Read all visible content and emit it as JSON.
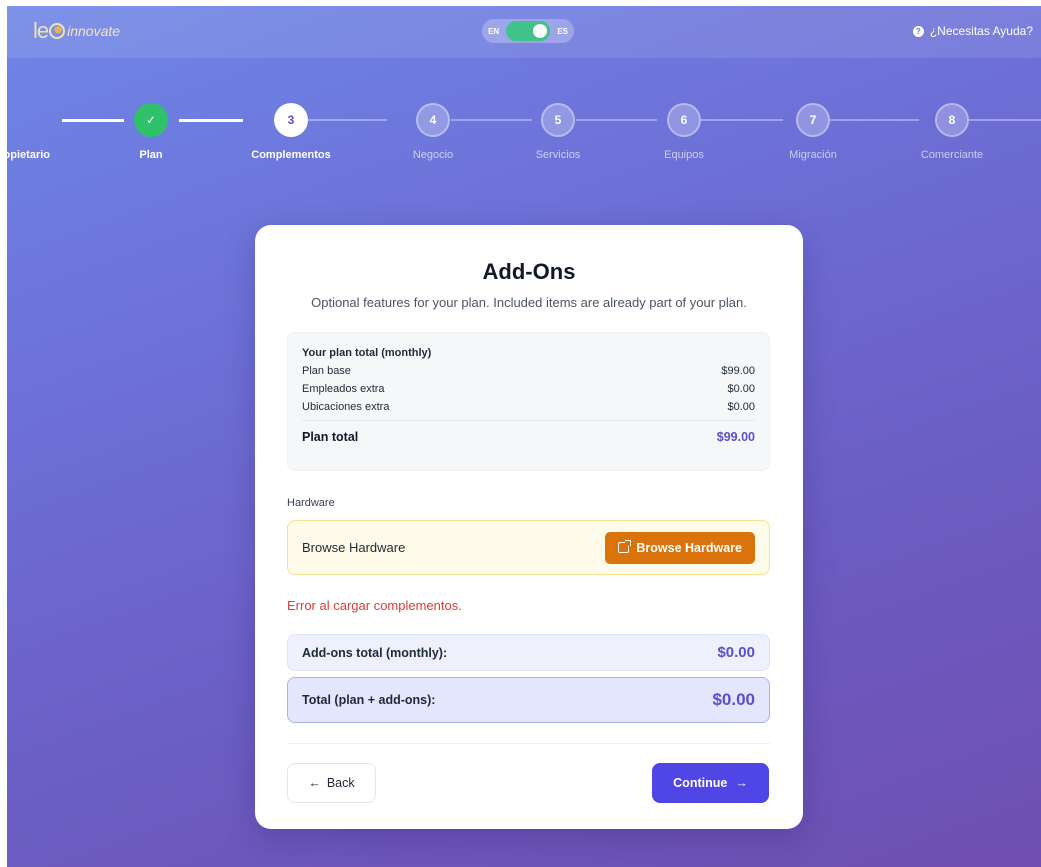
{
  "header": {
    "logo_le": "le",
    "logo_text": "innovate",
    "lang_left": "EN",
    "lang_right": "ES",
    "help": "¿Necesitas Ayuda?"
  },
  "stepper": {
    "steps": [
      {
        "num": "✓",
        "label": "opietario",
        "state": "done"
      },
      {
        "num": "✓",
        "label": "Plan",
        "state": "done"
      },
      {
        "num": "3",
        "label": "Complementos",
        "state": "active"
      },
      {
        "num": "4",
        "label": "Negocio",
        "state": "todo"
      },
      {
        "num": "5",
        "label": "Servicios",
        "state": "todo"
      },
      {
        "num": "6",
        "label": "Equipos",
        "state": "todo"
      },
      {
        "num": "7",
        "label": "Migración",
        "state": "todo"
      },
      {
        "num": "8",
        "label": "Comerciante",
        "state": "todo"
      }
    ]
  },
  "card": {
    "title": "Add-Ons",
    "subtitle": "Optional features for your plan. Included items are already part of your plan.",
    "summary": {
      "heading": "Your plan total (monthly)",
      "rows": [
        {
          "label": "Plan base",
          "value": "$99.00"
        },
        {
          "label": "Empleados extra",
          "value": "$0.00"
        },
        {
          "label": "Ubicaciones extra",
          "value": "$0.00"
        }
      ],
      "total_label": "Plan total",
      "total_value": "$99.00"
    },
    "hardware": {
      "section_label": "Hardware",
      "box_text": "Browse Hardware",
      "button_label": "Browse Hardware"
    },
    "error": "Error al cargar complementos.",
    "addons_total": {
      "label": "Add-ons total (monthly):",
      "value": "$0.00"
    },
    "grand_total": {
      "label": "Total (plan + add-ons):",
      "value": "$0.00"
    },
    "back_label": "Back",
    "continue_label": "Continue"
  },
  "colors": {
    "accent": "#4f46e5",
    "success": "#2fc26a",
    "hardware_button": "#d9730a",
    "error": "#dc3b3b"
  }
}
